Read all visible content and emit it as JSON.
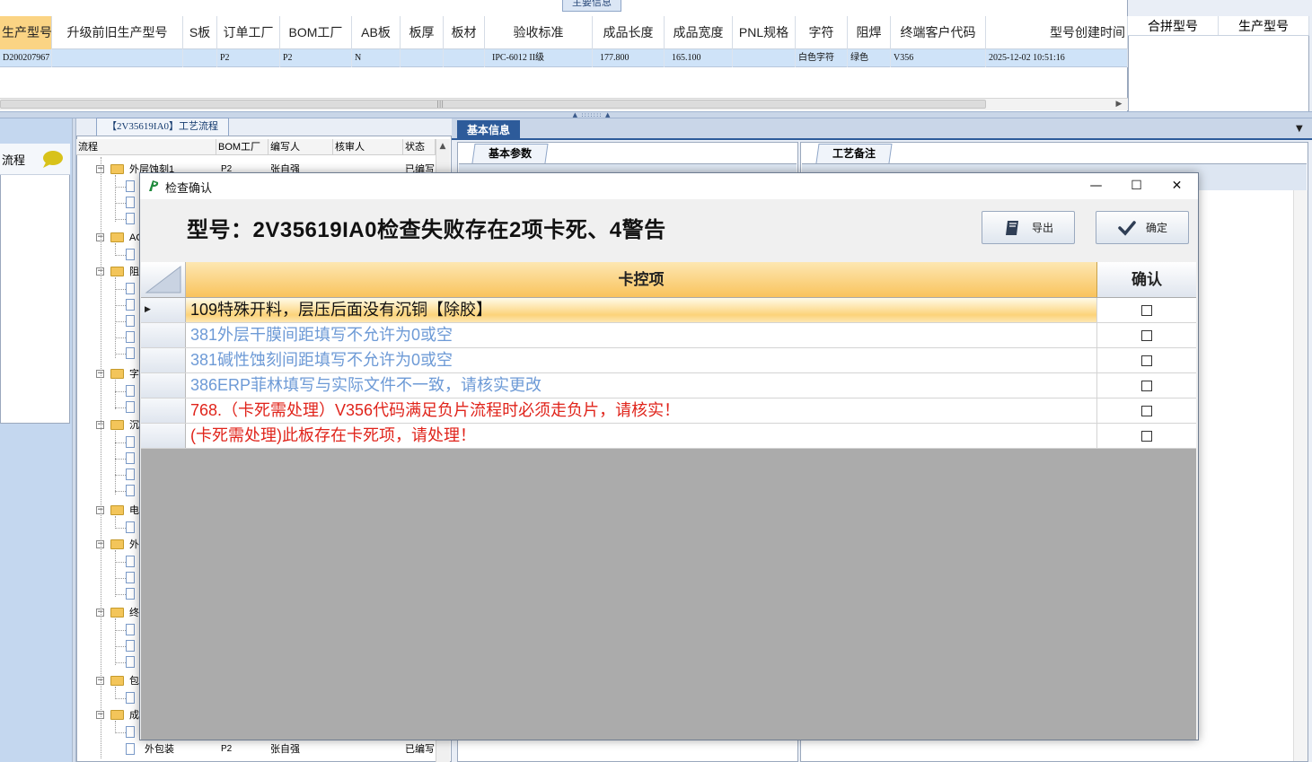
{
  "main_tab": "主要信息",
  "top_grid": {
    "headers": [
      "生产型号",
      "升级前旧生产型号",
      "S板",
      "订单工厂",
      "BOM工厂",
      "AB板",
      "板厚",
      "板材",
      "验收标准",
      "成品长度",
      "成品宽度",
      "PNL规格",
      "字符",
      "阻焊",
      "终端客户代码",
      "型号创建时间"
    ],
    "row": [
      "D200207967",
      "",
      "",
      "P2",
      "P2",
      "N",
      "",
      "",
      "IPC-6012 II级",
      "177.800",
      "165.100",
      "",
      "白色字符",
      "绿色",
      "V356",
      "2025-12-02 10:51:16"
    ]
  },
  "right_grid": {
    "headers": [
      "合拼型号",
      "生产型号"
    ]
  },
  "left_panel": {
    "title": "流程"
  },
  "tree": {
    "tab_title": "【2V35619IA0】工艺流程",
    "headers": [
      "流程",
      "BOM工厂",
      "编写人",
      "核审人",
      "状态"
    ],
    "rows": [
      {
        "name": "外层蚀刻1",
        "bom": "P2",
        "writer": "张自强",
        "status": "已编写"
      },
      {
        "name": "AO",
        "bom": "",
        "writer": "",
        "status": ""
      },
      {
        "name": "阻",
        "bom": "",
        "writer": "",
        "status": ""
      },
      {
        "name": "字",
        "bom": "",
        "writer": "",
        "status": ""
      },
      {
        "name": "沉",
        "bom": "",
        "writer": "",
        "status": ""
      },
      {
        "name": "电",
        "bom": "",
        "writer": "",
        "status": ""
      },
      {
        "name": "外",
        "bom": "",
        "writer": "",
        "status": ""
      },
      {
        "name": "终",
        "bom": "",
        "writer": "",
        "status": ""
      },
      {
        "name": "包",
        "bom": "",
        "writer": "",
        "status": ""
      },
      {
        "name": "成",
        "bom": "",
        "writer": "",
        "status": ""
      },
      {
        "name": "外包装",
        "bom": "P2",
        "writer": "张自强",
        "status": "已编写"
      }
    ]
  },
  "right_tabs": {
    "main": "基本信息",
    "panel1": "基本参数",
    "panel2": "工艺备注"
  },
  "dialog": {
    "title": "检查确认",
    "headline": "型号：2V35619IA0检查失败存在2项卡死、4警告",
    "export_label": "导出",
    "ok_label": "确定",
    "col_item": "卡控项",
    "col_confirm": "确认",
    "rows": [
      {
        "text": "109特殊开料，层压后面没有沉铜【除胶】",
        "color": "#111111"
      },
      {
        "text": "381外层干膜间距填写不允许为0或空",
        "color": "#6d9ad6"
      },
      {
        "text": "381碱性蚀刻间距填写不允许为0或空",
        "color": "#6d9ad6"
      },
      {
        "text": "386ERP菲林填写与实际文件不一致，请核实更改",
        "color": "#6d9ad6"
      },
      {
        "text": "768.（卡死需处理）V356代码满足负片流程时必须走负片，请核实！",
        "color": "#e0241b"
      },
      {
        "text": "(卡死需处理)此板存在卡死项，请处理！",
        "color": "#e0241b"
      }
    ]
  }
}
